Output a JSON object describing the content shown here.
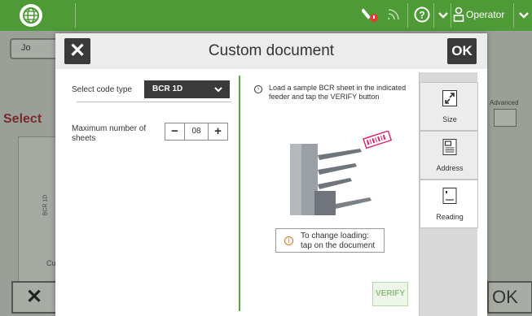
{
  "topbar": {
    "user_label": "Operator",
    "icons": [
      "globe-icon",
      "wrench-warning-icon",
      "wifi-icon",
      "help-icon",
      "chevron-down-icon",
      "user-icon",
      "chevron-down-icon"
    ],
    "accent_color": "#4d9a36"
  },
  "background": {
    "back_label": "Jo",
    "select_label": "Select",
    "advanced_label": "Advanced",
    "card_label": "BCR 1D",
    "card_bottom": "Cu",
    "close_label": "✕",
    "ok_label": "OK"
  },
  "dialog": {
    "title": "Custom document",
    "close_label": "✕",
    "ok_label": "OK",
    "select_code_type_label": "Select code type",
    "code_type_value": "BCR 1D",
    "max_sheets_label": "Maximum number of sheets",
    "max_sheets_value": "08",
    "minus_label": "−",
    "plus_label": "+",
    "instruction": "Load a sample BCR sheet in the indicated feeder and tap the VERIFY button",
    "hint_line1": "To change loading:",
    "hint_line2": "tap on the document",
    "verify_label": "VERIFY",
    "tabs": [
      {
        "label": "Size",
        "icon": "resize-icon",
        "active": false
      },
      {
        "label": "Address",
        "icon": "address-document-icon",
        "active": false
      },
      {
        "label": "Reading",
        "icon": "reading-document-icon",
        "active": true
      }
    ]
  }
}
